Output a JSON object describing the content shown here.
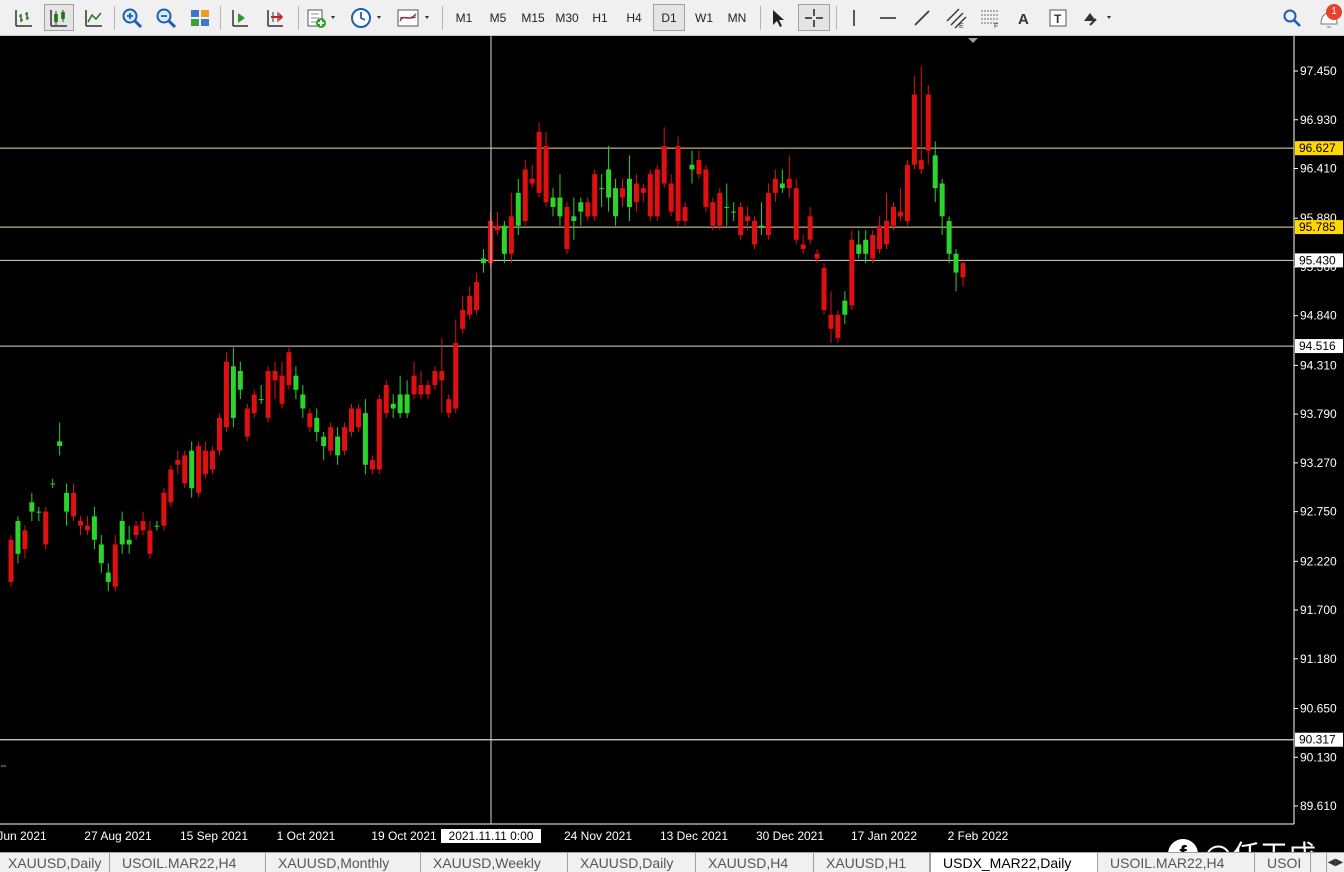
{
  "toolbar": {
    "timeframes": [
      "M1",
      "M5",
      "M15",
      "M30",
      "H1",
      "H4",
      "D1",
      "W1",
      "MN"
    ],
    "active_timeframe": "D1",
    "notification_count": "1",
    "icons": [
      "bar-chart-icon",
      "candlestick-chart-icon",
      "line-chart-icon",
      "zoom-in-icon",
      "zoom-out-icon",
      "tile-windows-icon",
      "chart-shift-icon",
      "autoscroll-icon",
      "new-order-icon",
      "clock-icon",
      "indicators-icon",
      "cursor-icon",
      "crosshair-icon",
      "vertical-line-icon",
      "horizontal-line-icon",
      "trendline-icon",
      "equidistant-channel-icon",
      "fibonacci-icon",
      "text-icon",
      "text-label-icon",
      "arrows-icon",
      "search-icon",
      "notification-icon"
    ]
  },
  "chart": {
    "price_axis": [
      "97.450",
      "96.930",
      "96.410",
      "95.880",
      "95.360",
      "94.840",
      "94.310",
      "93.790",
      "93.270",
      "92.750",
      "92.220",
      "91.700",
      "91.180",
      "90.650",
      "90.130",
      "89.610"
    ],
    "date_axis": [
      "Jun 2021",
      "27 Aug 2021",
      "15 Sep 2021",
      "1 Oct 2021",
      "19 Oct 2021",
      "24 Nov 2021",
      "13 Dec 2021",
      "30 Dec 2021",
      "17 Jan 2022",
      "2 Feb 2022"
    ],
    "crosshair_time": "2021.11.11 0:00",
    "price_labels": [
      {
        "text": "96.627",
        "style": "highlight"
      },
      {
        "text": "95.785",
        "style": "highlight"
      },
      {
        "text": "95.430",
        "style": "plain"
      },
      {
        "text": "94.516",
        "style": "plain"
      },
      {
        "text": "90.317",
        "style": "plain"
      }
    ],
    "colors": {
      "bull": "#2dd32d",
      "bear": "#e01010",
      "background": "#000000",
      "highlight_label": "#ffd700",
      "level_line": "#e8e0a0"
    }
  },
  "chart_data": {
    "type": "candlestick",
    "symbol": "USDX_MAR22",
    "timeframe": "Daily",
    "y_range": [
      89.61,
      97.66
    ],
    "levels": [
      96.627,
      95.785,
      95.43,
      94.516,
      90.317
    ],
    "candles": [
      [
        92.45,
        92.45,
        92.1,
        92.0,
        0
      ],
      [
        92.3,
        92.55,
        92.25,
        92.65,
        1
      ],
      [
        92.55,
        92.55,
        92.3,
        92.35,
        0
      ],
      [
        92.75,
        92.9,
        92.7,
        92.85,
        1
      ],
      [
        92.75,
        92.75,
        92.7,
        92.75,
        0
      ],
      [
        92.75,
        92.75,
        92.45,
        92.4,
        0
      ],
      [
        93.05,
        93.05,
        93.05,
        93.05,
        0
      ],
      [
        93.45,
        93.65,
        93.4,
        93.5,
        1
      ],
      [
        92.75,
        93.0,
        92.65,
        92.95,
        1
      ],
      [
        92.95,
        93.0,
        92.8,
        92.7,
        0
      ],
      [
        92.65,
        92.6,
        92.55,
        92.6,
        0
      ],
      [
        92.6,
        92.65,
        92.6,
        92.55,
        0
      ],
      [
        92.45,
        92.75,
        92.4,
        92.7,
        1
      ],
      [
        92.2,
        92.45,
        92.15,
        92.4,
        1
      ],
      [
        92.0,
        92.15,
        91.95,
        92.1,
        1
      ],
      [
        92.4,
        92.45,
        92.0,
        91.95,
        0
      ],
      [
        92.4,
        92.7,
        92.35,
        92.65,
        1
      ],
      [
        92.4,
        92.55,
        92.35,
        92.45,
        1
      ],
      [
        92.6,
        92.6,
        92.5,
        92.5,
        0
      ],
      [
        92.65,
        92.7,
        92.6,
        92.55,
        0
      ],
      [
        92.55,
        92.6,
        92.5,
        92.3,
        1
      ],
      [
        92.6,
        92.6,
        92.6,
        92.6,
        0
      ],
      [
        92.95,
        92.95,
        92.65,
        92.6,
        0
      ],
      [
        93.2,
        93.2,
        92.9,
        92.85,
        0
      ],
      [
        93.3,
        93.35,
        93.2,
        93.25,
        1
      ],
      [
        93.35,
        93.35,
        93.15,
        93.05,
        1
      ],
      [
        93.0,
        93.45,
        92.95,
        93.4,
        1
      ],
      [
        93.45,
        93.45,
        93.0,
        92.95,
        0
      ],
      [
        93.4,
        93.45,
        93.2,
        93.15,
        1
      ],
      [
        93.4,
        93.4,
        93.25,
        93.2,
        0
      ],
      [
        93.75,
        93.75,
        93.5,
        93.4,
        0
      ],
      [
        94.35,
        94.4,
        93.7,
        93.65,
        0
      ],
      [
        93.75,
        94.45,
        93.7,
        94.3,
        1
      ],
      [
        94.05,
        94.3,
        94.0,
        94.25,
        1
      ],
      [
        93.85,
        93.85,
        93.6,
        93.55,
        1
      ],
      [
        94.0,
        94.0,
        93.85,
        93.8,
        0
      ],
      [
        93.95,
        94.05,
        93.95,
        93.95,
        0
      ],
      [
        94.25,
        94.25,
        93.8,
        93.75,
        0
      ],
      [
        94.25,
        94.3,
        94.0,
        94.15,
        1
      ],
      [
        94.2,
        94.3,
        93.95,
        93.9,
        1
      ],
      [
        94.45,
        94.45,
        94.15,
        94.1,
        0
      ],
      [
        94.05,
        94.25,
        94.0,
        94.2,
        1
      ],
      [
        93.85,
        94.05,
        93.8,
        94.0,
        1
      ],
      [
        93.8,
        93.75,
        93.7,
        93.65,
        1
      ],
      [
        93.6,
        93.8,
        93.55,
        93.75,
        1
      ],
      [
        93.45,
        93.55,
        93.35,
        93.55,
        1
      ],
      [
        93.65,
        93.65,
        93.4,
        93.4,
        0
      ],
      [
        93.35,
        93.6,
        93.3,
        93.55,
        1
      ],
      [
        93.65,
        93.65,
        93.45,
        93.4,
        0
      ],
      [
        93.85,
        93.85,
        93.6,
        93.6,
        1
      ],
      [
        93.85,
        93.85,
        93.7,
        93.65,
        0
      ],
      [
        93.25,
        93.9,
        93.2,
        93.8,
        1
      ],
      [
        93.3,
        93.3,
        93.25,
        93.2,
        1
      ],
      [
        93.95,
        93.95,
        93.25,
        93.2,
        0
      ],
      [
        94.1,
        94.1,
        93.8,
        93.8,
        1
      ],
      [
        93.85,
        93.95,
        93.8,
        93.9,
        1
      ],
      [
        93.8,
        94.15,
        93.8,
        94.0,
        1
      ],
      [
        93.8,
        94.1,
        93.8,
        94.0,
        0
      ],
      [
        94.2,
        94.3,
        94.0,
        94.0,
        0
      ],
      [
        94.1,
        94.2,
        94.0,
        94.0,
        0
      ],
      [
        94.1,
        94.1,
        94.05,
        94.0,
        1
      ],
      [
        94.25,
        94.25,
        94.1,
        94.1,
        0
      ],
      [
        94.25,
        94.55,
        93.85,
        94.15,
        0
      ],
      [
        93.95,
        93.95,
        93.8,
        93.8,
        1
      ],
      [
        94.55,
        94.75,
        93.85,
        93.85,
        0
      ],
      [
        94.9,
        95.0,
        94.7,
        94.7,
        0
      ],
      [
        95.05,
        95.1,
        94.85,
        94.85,
        0
      ],
      [
        95.2,
        95.25,
        94.9,
        94.9,
        0
      ],
      [
        95.4,
        95.5,
        95.35,
        95.45,
        0
      ],
      [
        95.85,
        95.9,
        95.45,
        95.4,
        0
      ],
      [
        95.8,
        95.9,
        95.75,
        95.75,
        0
      ],
      [
        95.5,
        95.8,
        95.45,
        95.8,
        1
      ],
      [
        95.9,
        96.1,
        95.45,
        95.5,
        0
      ],
      [
        95.8,
        96.25,
        95.75,
        96.15,
        0
      ],
      [
        96.4,
        96.45,
        95.85,
        95.85,
        0
      ],
      [
        96.3,
        96.4,
        96.25,
        96.25,
        0
      ],
      [
        96.8,
        96.85,
        96.15,
        96.15,
        0
      ],
      [
        96.65,
        96.75,
        96.1,
        96.05,
        1
      ],
      [
        96.0,
        96.15,
        95.95,
        96.1,
        1
      ],
      [
        95.9,
        96.3,
        95.85,
        96.1,
        1
      ],
      [
        96.0,
        96.0,
        95.55,
        95.55,
        0
      ],
      [
        95.85,
        96.05,
        95.7,
        95.9,
        1
      ],
      [
        95.95,
        96.05,
        95.85,
        96.05,
        0
      ],
      [
        96.05,
        96.05,
        95.9,
        95.9,
        0
      ],
      [
        96.35,
        96.35,
        95.95,
        95.9,
        0
      ],
      [
        96.2,
        96.3,
        96.05,
        96.2,
        0
      ],
      [
        96.1,
        96.6,
        96.0,
        96.4,
        1
      ],
      [
        95.9,
        96.25,
        95.85,
        96.2,
        1
      ],
      [
        96.2,
        96.25,
        96.05,
        96.1,
        0
      ],
      [
        96.0,
        96.5,
        95.9,
        96.3,
        1
      ],
      [
        96.25,
        96.3,
        96.0,
        96.05,
        1
      ],
      [
        96.2,
        96.2,
        96.1,
        96.15,
        0
      ],
      [
        96.35,
        96.35,
        96.0,
        95.9,
        0
      ],
      [
        96.4,
        96.4,
        95.9,
        95.9,
        1
      ],
      [
        96.65,
        96.8,
        96.25,
        96.25,
        0
      ],
      [
        96.25,
        96.3,
        96.0,
        95.95,
        0
      ],
      [
        96.65,
        96.7,
        95.95,
        95.85,
        0
      ],
      [
        96.0,
        96.0,
        95.85,
        95.85,
        1
      ],
      [
        96.4,
        96.55,
        96.3,
        96.45,
        0
      ],
      [
        96.5,
        96.55,
        96.35,
        96.35,
        0
      ],
      [
        96.4,
        96.4,
        96.0,
        96.0,
        1
      ],
      [
        96.05,
        96.05,
        95.85,
        95.8,
        0
      ],
      [
        96.15,
        96.15,
        95.85,
        95.8,
        1
      ],
      [
        96.0,
        96.2,
        95.85,
        96.0,
        0
      ],
      [
        95.95,
        96.0,
        95.9,
        95.95,
        0
      ],
      [
        96.0,
        96.0,
        95.7,
        95.7,
        1
      ],
      [
        95.9,
        95.95,
        95.8,
        95.85,
        0
      ],
      [
        95.85,
        95.85,
        95.6,
        95.6,
        1
      ],
      [
        95.8,
        96.0,
        95.75,
        95.8,
        0
      ],
      [
        96.15,
        96.2,
        95.7,
        95.7,
        0
      ],
      [
        96.3,
        96.35,
        96.1,
        96.15,
        0
      ],
      [
        96.2,
        96.35,
        96.2,
        96.25,
        1
      ],
      [
        96.3,
        96.5,
        96.15,
        96.2,
        0
      ],
      [
        96.2,
        96.25,
        95.65,
        95.65,
        1
      ],
      [
        95.6,
        95.65,
        95.55,
        95.55,
        1
      ],
      [
        95.9,
        95.95,
        95.65,
        95.65,
        1
      ],
      [
        95.5,
        95.5,
        95.45,
        95.45,
        0
      ],
      [
        95.35,
        95.35,
        94.9,
        94.9,
        1
      ],
      [
        94.85,
        95.05,
        94.6,
        94.7,
        1
      ],
      [
        94.85,
        94.85,
        94.6,
        94.6,
        0
      ],
      [
        94.85,
        95.05,
        94.8,
        95.0,
        0
      ],
      [
        95.65,
        95.7,
        94.95,
        94.95,
        0
      ],
      [
        95.5,
        95.7,
        95.5,
        95.6,
        0
      ],
      [
        95.5,
        95.7,
        95.45,
        95.65,
        1
      ],
      [
        95.7,
        95.7,
        95.45,
        95.45,
        0
      ],
      [
        95.8,
        95.85,
        95.55,
        95.55,
        0
      ],
      [
        95.85,
        96.1,
        95.6,
        95.6,
        0
      ],
      [
        96.0,
        96.0,
        95.8,
        95.8,
        1
      ],
      [
        95.95,
        96.15,
        95.9,
        95.9,
        0
      ],
      [
        96.45,
        96.45,
        95.85,
        95.85,
        0
      ],
      [
        97.2,
        97.35,
        96.45,
        96.45,
        0
      ],
      [
        96.5,
        97.45,
        96.5,
        96.4,
        0
      ],
      [
        97.2,
        97.25,
        96.5,
        96.6,
        1
      ],
      [
        96.2,
        96.65,
        96.1,
        96.55,
        1
      ],
      [
        95.9,
        96.2,
        95.75,
        96.25,
        1
      ],
      [
        95.5,
        95.8,
        95.45,
        95.85,
        1
      ],
      [
        95.3,
        95.45,
        95.15,
        95.5,
        1
      ],
      [
        95.4,
        95.4,
        95.2,
        95.25,
        0
      ]
    ]
  },
  "tabs": {
    "items": [
      "XAUUSD,Daily",
      "USOIL.MAR22,H4",
      "XAUUSD,Monthly",
      "XAUUSD,Weekly",
      "XAUUSD,Daily",
      "XAUUSD,H4",
      "XAUUSD,H1",
      "USDX_MAR22,Daily",
      "USOIL.MAR22,H4",
      "USOI"
    ],
    "active_index": 7
  },
  "watermark": {
    "text": "@任天成",
    "logo": "f"
  }
}
